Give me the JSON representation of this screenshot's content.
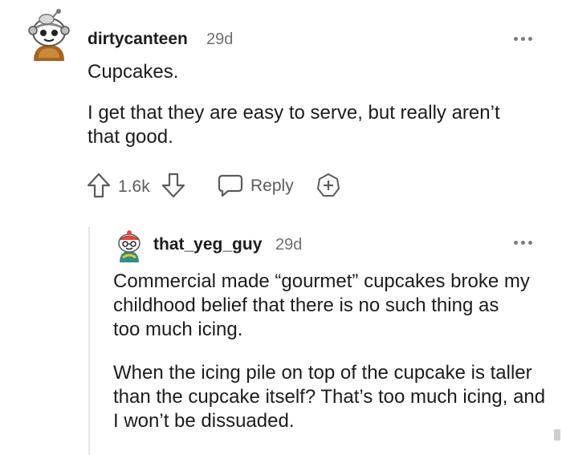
{
  "comment": {
    "avatar_icon": "snoo-avatar-icon",
    "username": "dirtycanteen",
    "age": "29d",
    "paragraphs": [
      "Cupcakes.",
      "I get that they are easy to serve, but really aren’t that good."
    ],
    "vote_count": "1.6k",
    "reply_label": "Reply",
    "more_icon": "more-options-icon"
  },
  "reply": {
    "avatar_icon": "snoo-avatar-icon",
    "username": "that_yeg_guy",
    "age": "29d",
    "paragraphs": [
      "Commercial made “gourmet” cupcakes broke my childhood belief that there is no such thing as too much icing.",
      "When the icing pile on top of the cupcake is taller than the cupcake itself? That’s too much icing, and I won’t be dissuaded."
    ],
    "more_icon": "more-options-icon"
  },
  "colors": {
    "text": "#1c1c1c",
    "muted": "#6f6f6f",
    "icon": "#5b5b5b",
    "thread_line": "#e5e5e5"
  }
}
